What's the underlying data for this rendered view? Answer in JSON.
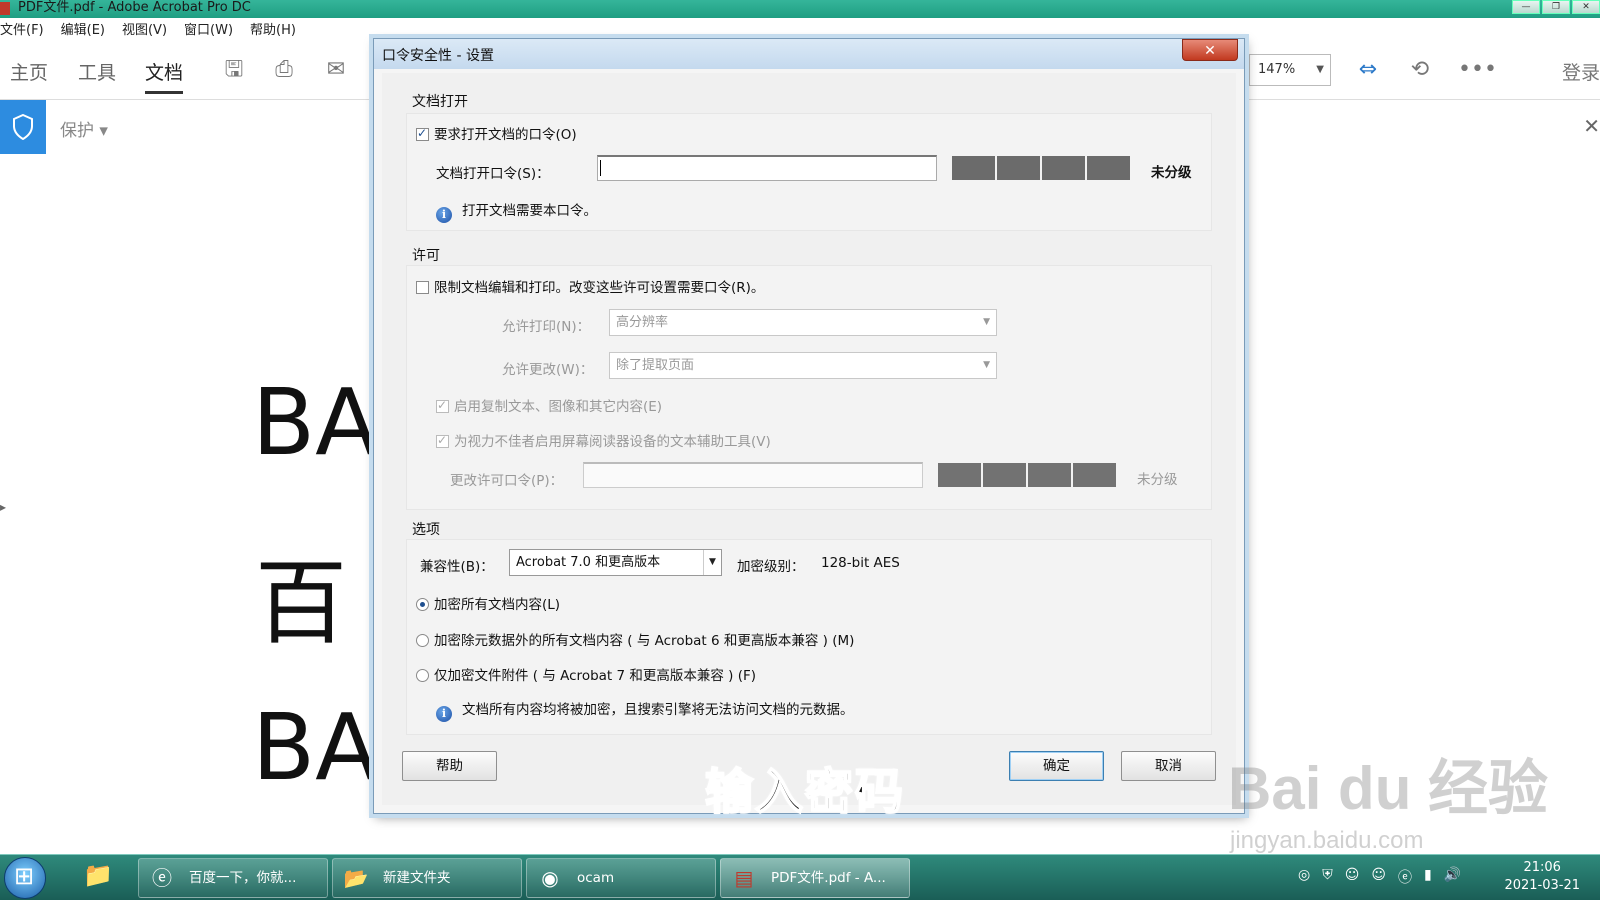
{
  "window": {
    "title": "PDF文件.pdf - Adobe Acrobat Pro DC"
  },
  "menu": [
    "文件(F)",
    "编辑(E)",
    "视图(V)",
    "窗口(W)",
    "帮助(H)"
  ],
  "toolbar": {
    "tabs": [
      "主页",
      "工具",
      "文档"
    ],
    "active_tab": "文档",
    "zoom": "147%",
    "login": "登录"
  },
  "protect_bar": {
    "label": "保护 ▾"
  },
  "document": {
    "lines": [
      "BA",
      "百",
      "BA"
    ]
  },
  "dialog": {
    "title": "口令安全性 - 设置",
    "open_section": {
      "label": "文档打开",
      "require_open_pw": {
        "label": "要求打开文档的口令(O)",
        "checked": true
      },
      "open_pw_label": "文档打开口令(S)：",
      "open_pw_value": "",
      "strength_label": "未分级",
      "info": "打开文档需要本口令。"
    },
    "permission_section": {
      "label": "许可",
      "restrict": {
        "label": "限制文档编辑和打印。改变这些许可设置需要口令(R)。",
        "checked": false
      },
      "print_label": "允许打印(N)：",
      "print_value": "高分辨率",
      "change_label": "允许更改(W)：",
      "change_value": "除了提取页面",
      "enable_copy": {
        "label": "启用复制文本、图像和其它内容(E)",
        "checked": true
      },
      "enable_reader": {
        "label": "为视力不佳者启用屏幕阅读器设备的文本辅助工具(V)",
        "checked": true
      },
      "perm_pw_label": "更改许可口令(P)：",
      "strength_label": "未分级"
    },
    "options_section": {
      "label": "选项",
      "compat_label": "兼容性(B)：",
      "compat_value": "Acrobat 7.0 和更高版本",
      "encrypt_level_label": "加密级别：",
      "encrypt_level_value": "128-bit AES",
      "radios": [
        {
          "label": "加密所有文档内容(L)",
          "selected": true
        },
        {
          "label": "加密除元数据外的所有文档内容 ( 与 Acrobat 6 和更高版本兼容 ) (M)",
          "selected": false
        },
        {
          "label": "仅加密文件附件 ( 与 Acrobat 7 和更高版本兼容 ) (F)",
          "selected": false
        }
      ],
      "info": "文档所有内容均将被加密，且搜索引擎将无法访问文档的元数据。"
    },
    "buttons": {
      "help": "帮助",
      "ok": "确定",
      "cancel": "取消"
    }
  },
  "caption": "输入密码",
  "watermark": {
    "brand": "Bai du 经验",
    "url": "jingyan.baidu.com"
  },
  "taskbar": {
    "items": [
      {
        "label": "百度一下，你就...",
        "icon": "ie-icon"
      },
      {
        "label": "新建文件夹",
        "icon": "folder-icon"
      },
      {
        "label": "ocam",
        "icon": "ocam-icon"
      },
      {
        "label": "PDF文件.pdf - A...",
        "icon": "pdf-icon"
      }
    ],
    "time": "21:06",
    "date": "2021-03-21"
  }
}
